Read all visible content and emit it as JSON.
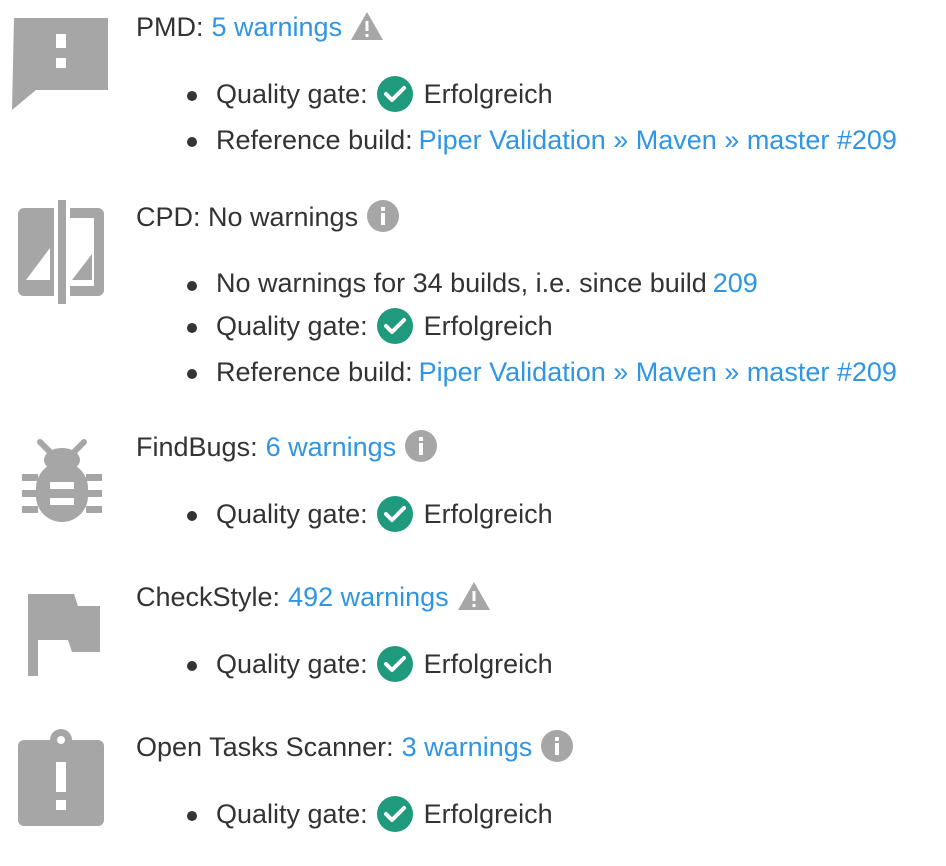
{
  "colors": {
    "link": "#2f95e4",
    "text": "#333333",
    "icon_gray": "#a6a6a6",
    "success_green": "#1f9a7c"
  },
  "tools": [
    {
      "name": "PMD:",
      "link": "5 warnings",
      "tool_icon": "comment-alert-icon",
      "status_icon": "warning-triangle-icon",
      "quality_gate_label": "Quality gate:",
      "quality_gate_value": "Erfolgreich",
      "reference_label": "Reference build:",
      "reference_link": "Piper Validation » Maven » master #209"
    },
    {
      "name": "CPD: No warnings",
      "tool_icon": "compare-icon",
      "status_icon": "info-icon",
      "no_warnings_text": "No warnings for 34 builds, i.e. since build",
      "no_warnings_link": "209",
      "quality_gate_label": "Quality gate:",
      "quality_gate_value": "Erfolgreich",
      "reference_label": "Reference build:",
      "reference_link": "Piper Validation » Maven » master #209"
    },
    {
      "name": "FindBugs:",
      "link": "6 warnings",
      "tool_icon": "bug-icon",
      "status_icon": "info-icon",
      "quality_gate_label": "Quality gate:",
      "quality_gate_value": "Erfolgreich"
    },
    {
      "name": "CheckStyle:",
      "link": "492 warnings",
      "tool_icon": "flag-icon",
      "status_icon": "warning-triangle-icon",
      "quality_gate_label": "Quality gate:",
      "quality_gate_value": "Erfolgreich"
    },
    {
      "name": "Open Tasks Scanner:",
      "link": "3 warnings",
      "tool_icon": "clipboard-alert-icon",
      "status_icon": "info-icon",
      "quality_gate_label": "Quality gate:",
      "quality_gate_value": "Erfolgreich"
    }
  ]
}
